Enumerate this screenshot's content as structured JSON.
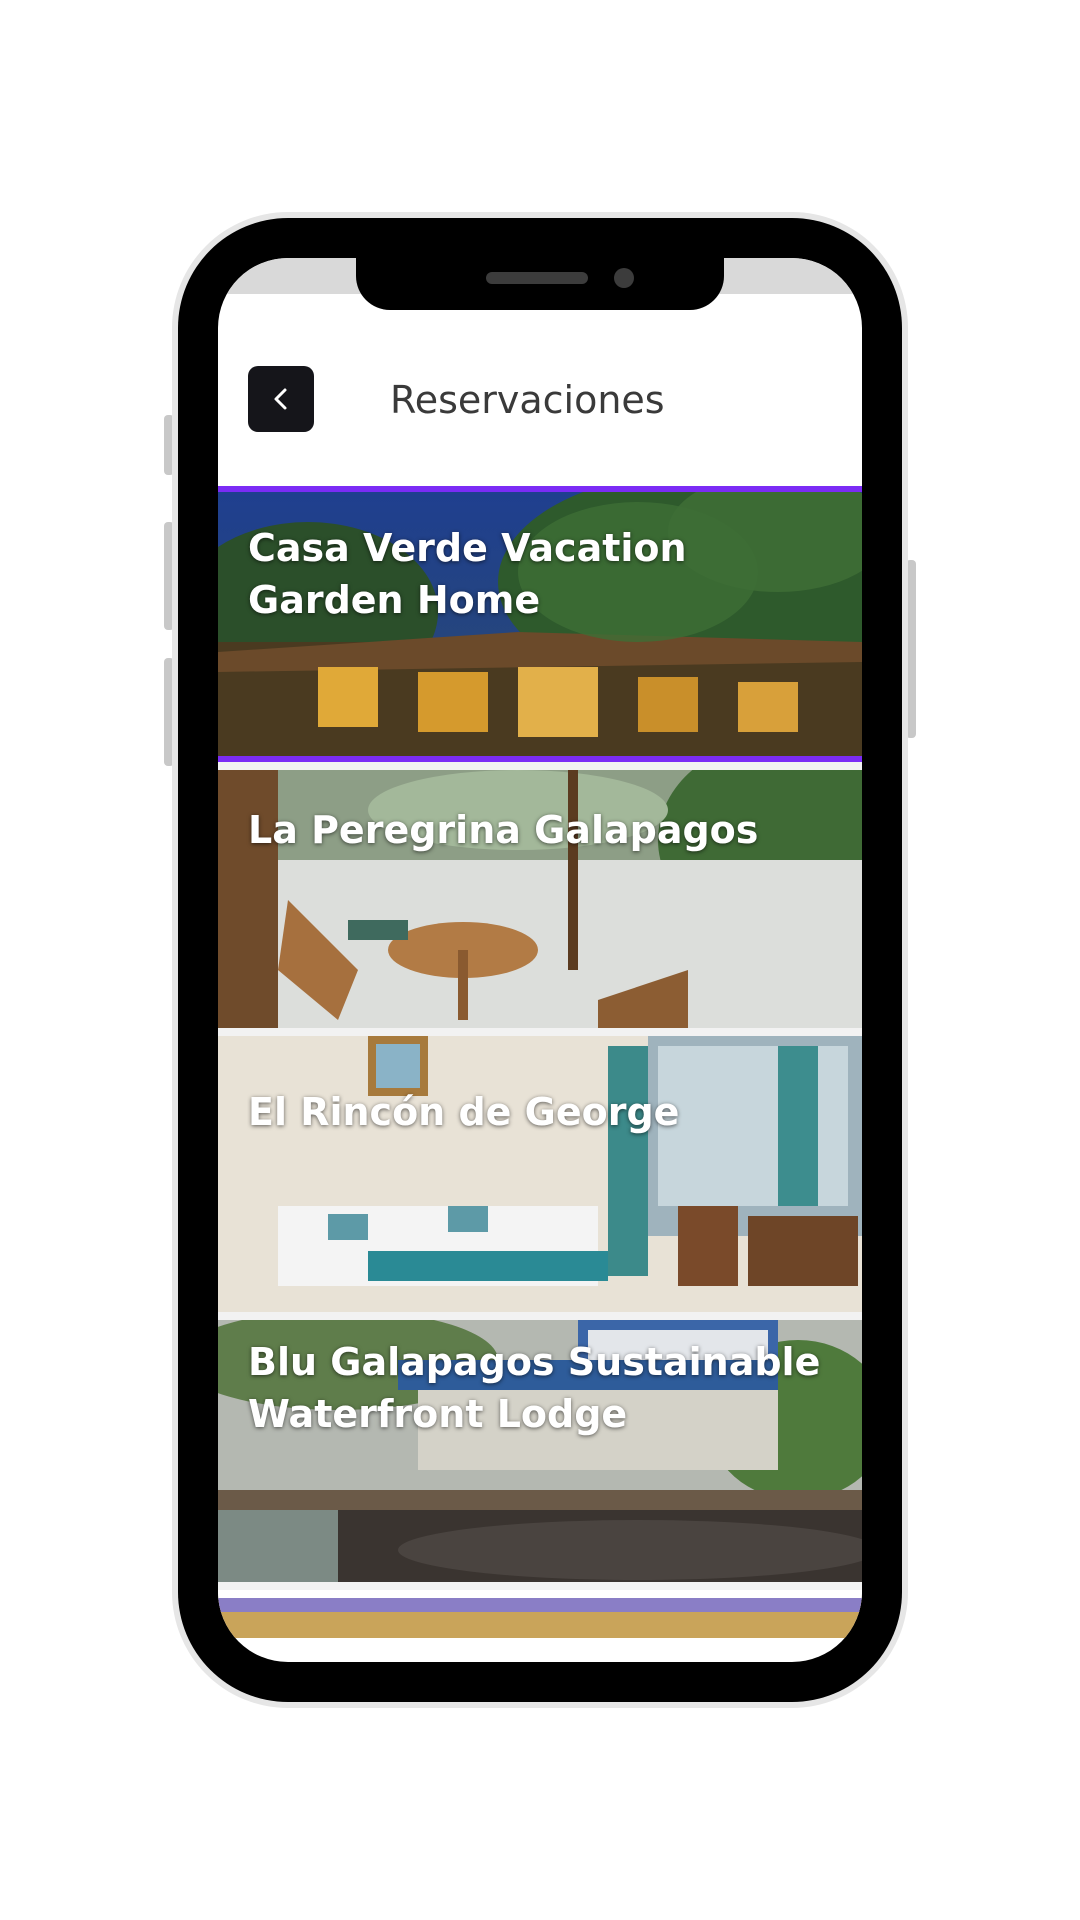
{
  "header": {
    "title": "Reservaciones",
    "back_icon": "chevron-left-icon"
  },
  "colors": {
    "back_button_bg": "#15151a",
    "selected_border": "#7b2cf5",
    "title_text": "#3a3a3a"
  },
  "reservations": [
    {
      "name": "Casa Verde Vacation Garden Home",
      "selected": true
    },
    {
      "name": "La Peregrina Galapagos",
      "selected": false
    },
    {
      "name": "El Rincón de George",
      "selected": false
    },
    {
      "name": "Blu Galapagos Sustainable Waterfront Lodge",
      "selected": false
    }
  ]
}
